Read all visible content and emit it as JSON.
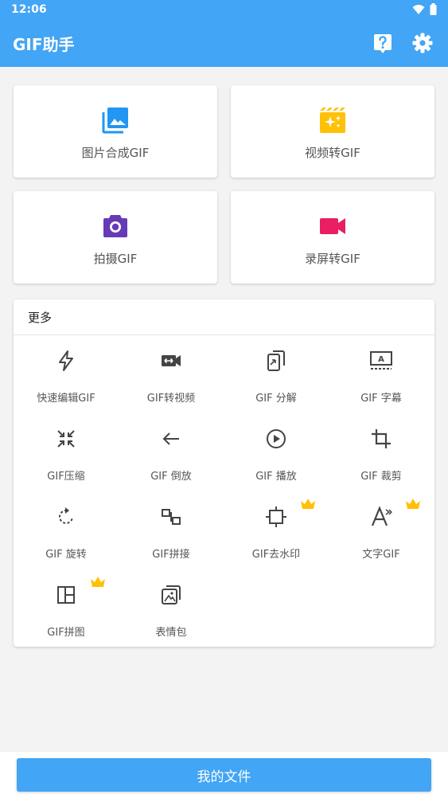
{
  "status": {
    "time": "12:06"
  },
  "appbar": {
    "title": "GIF助手",
    "help_icon": "help-icon",
    "settings_icon": "gear-icon"
  },
  "main_cards": [
    {
      "label": "图片合成GIF",
      "icon": "photo-library-icon",
      "color": "#2196f3"
    },
    {
      "label": "视频转GIF",
      "icon": "movie-sparkle-icon",
      "color": "#ffc107"
    },
    {
      "label": "拍摄GIF",
      "icon": "camera-icon",
      "color": "#673ab7"
    },
    {
      "label": "录屏转GIF",
      "icon": "video-camera-icon",
      "color": "#e91e63"
    }
  ],
  "more": {
    "title": "更多",
    "items": [
      {
        "label": "快速编辑GIF",
        "icon": "flash-icon",
        "premium": false
      },
      {
        "label": "GIF转视频",
        "icon": "video-convert-icon",
        "premium": false
      },
      {
        "label": "GIF 分解",
        "icon": "split-icon",
        "premium": false
      },
      {
        "label": "GIF 字幕",
        "icon": "subtitle-icon",
        "premium": false
      },
      {
        "label": "GIF压缩",
        "icon": "compress-icon",
        "premium": false
      },
      {
        "label": "GIF 倒放",
        "icon": "arrow-back-icon",
        "premium": false
      },
      {
        "label": "GIF 播放",
        "icon": "play-circle-icon",
        "premium": false
      },
      {
        "label": "GIF 裁剪",
        "icon": "crop-icon",
        "premium": false
      },
      {
        "label": "GIF 旋转",
        "icon": "rotate-icon",
        "premium": false
      },
      {
        "label": "GIF拼接",
        "icon": "join-icon",
        "premium": false
      },
      {
        "label": "GIF去水印",
        "icon": "watermark-remove-icon",
        "premium": true
      },
      {
        "label": "文字GIF",
        "icon": "text-icon",
        "premium": true
      },
      {
        "label": "GIF拼图",
        "icon": "collage-icon",
        "premium": true
      },
      {
        "label": "表情包",
        "icon": "sticker-icon",
        "premium": false
      }
    ]
  },
  "bottom": {
    "button_label": "我的文件"
  },
  "colors": {
    "primary": "#42a5f5",
    "crown": "#ffc107"
  }
}
